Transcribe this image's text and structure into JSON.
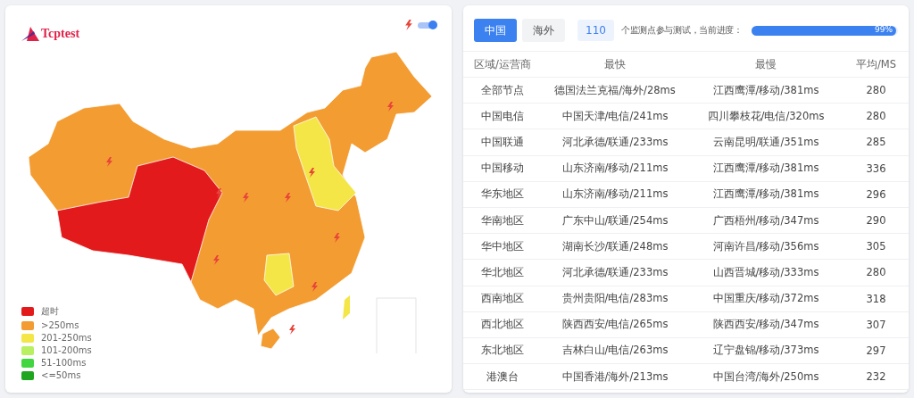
{
  "logo": {
    "text": "Tcptest"
  },
  "toggle": {
    "on": true
  },
  "legend": [
    {
      "label": "超时",
      "color": "#e31a1c"
    },
    {
      "label": ">250ms",
      "color": "#f39c32"
    },
    {
      "label": "201-250ms",
      "color": "#f3e646"
    },
    {
      "label": "101-200ms",
      "color": "#b8f061"
    },
    {
      "label": "51-100ms",
      "color": "#41d63f"
    },
    {
      "label": "<=50ms",
      "color": "#1fa51f"
    }
  ],
  "tabs": [
    {
      "label": "中国",
      "selected": true
    },
    {
      "label": "海外",
      "selected": false
    }
  ],
  "node_count": "110",
  "progress_text": "个监测点参与测试，当前进度：",
  "progress": {
    "level": 0.99,
    "reading": "99%"
  },
  "table": {
    "columns": [
      "区域/运营商",
      "最快",
      "最慢",
      "平均/MS"
    ],
    "rows": [
      [
        "全部节点",
        "德国法兰克福/海外/28ms",
        "江西鹰潭/移动/381ms",
        "280"
      ],
      [
        "中国电信",
        "中国天津/电信/241ms",
        "四川攀枝花/电信/320ms",
        "280"
      ],
      [
        "中国联通",
        "河北承德/联通/233ms",
        "云南昆明/联通/351ms",
        "285"
      ],
      [
        "中国移动",
        "山东济南/移动/211ms",
        "江西鹰潭/移动/381ms",
        "336"
      ],
      [
        "华东地区",
        "山东济南/移动/211ms",
        "江西鹰潭/移动/381ms",
        "296"
      ],
      [
        "华南地区",
        "广东中山/联通/254ms",
        "广西梧州/移动/347ms",
        "290"
      ],
      [
        "华中地区",
        "湖南长沙/联通/248ms",
        "河南许昌/移动/356ms",
        "305"
      ],
      [
        "华北地区",
        "河北承德/联通/233ms",
        "山西晋城/移动/333ms",
        "280"
      ],
      [
        "西南地区",
        "贵州贵阳/电信/283ms",
        "中国重庆/移动/372ms",
        "318"
      ],
      [
        "西北地区",
        "陕西西安/电信/265ms",
        "陕西西安/移动/347ms",
        "307"
      ],
      [
        "东北地区",
        "吉林白山/电信/263ms",
        "辽宁盘锦/移动/373ms",
        "297"
      ],
      [
        "港澳台",
        "中国香港/海外/213ms",
        "中国台湾/海外/250ms",
        "232"
      ]
    ]
  }
}
